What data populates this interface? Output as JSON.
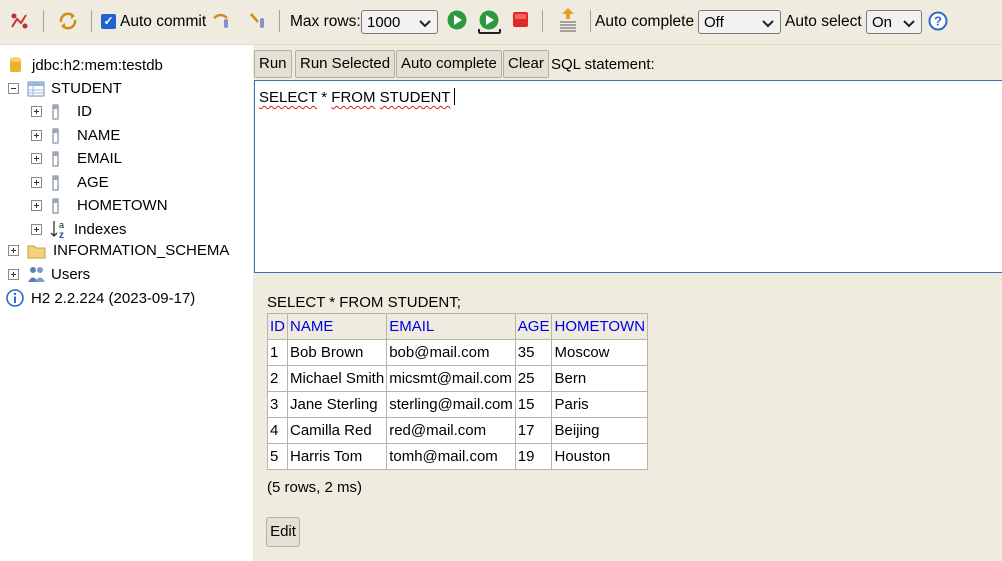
{
  "toolbar": {
    "auto_commit_label": "Auto commit",
    "auto_commit_checked": true,
    "max_rows_label": "Max rows:",
    "max_rows_value": "1000",
    "auto_complete_label": "Auto complete",
    "auto_complete_value": "Off",
    "auto_select_label": "Auto select",
    "auto_select_value": "On",
    "icons": [
      "disconnect-icon",
      "refresh-icon",
      "rollback-icon",
      "commit-icon",
      "run-icon",
      "run-selected-icon",
      "stop-icon",
      "history-icon",
      "help-icon"
    ]
  },
  "tree": {
    "connection": "jdbc:h2:mem:testdb",
    "table": "STUDENT",
    "columns": [
      "ID",
      "NAME",
      "EMAIL",
      "AGE",
      "HOMETOWN"
    ],
    "indexes": "Indexes",
    "schema": "INFORMATION_SCHEMA",
    "users": "Users",
    "version": "H2 2.2.224 (2023-09-17)"
  },
  "sql_toolbar": {
    "run": "Run",
    "run_selected": "Run Selected",
    "auto_complete": "Auto complete",
    "clear": "Clear",
    "sql_label": "SQL statement:"
  },
  "editor": {
    "words": [
      "SELECT",
      "*",
      "FROM",
      "STUDENT"
    ]
  },
  "result": {
    "query": "SELECT * FROM STUDENT;",
    "headers": [
      "ID",
      "NAME",
      "EMAIL",
      "AGE",
      "HOMETOWN"
    ],
    "rows": [
      [
        "1",
        "Bob Brown",
        "bob@mail.com",
        "35",
        "Moscow"
      ],
      [
        "2",
        "Michael Smith",
        "micsmt@mail.com",
        "25",
        "Bern"
      ],
      [
        "3",
        "Jane Sterling",
        "sterling@mail.com",
        "15",
        "Paris"
      ],
      [
        "4",
        "Camilla Red",
        "red@mail.com",
        "17",
        "Beijing"
      ],
      [
        "5",
        "Harris Tom",
        "tomh@mail.com",
        "19",
        "Houston"
      ]
    ],
    "row_count": "(5 rows, 2 ms)",
    "edit": "Edit"
  },
  "colors": {
    "panel_bg": "#efebde",
    "header_link": "#0000e6",
    "editor_border": "#3b6fb6",
    "checkbox": "#1e63d6"
  }
}
